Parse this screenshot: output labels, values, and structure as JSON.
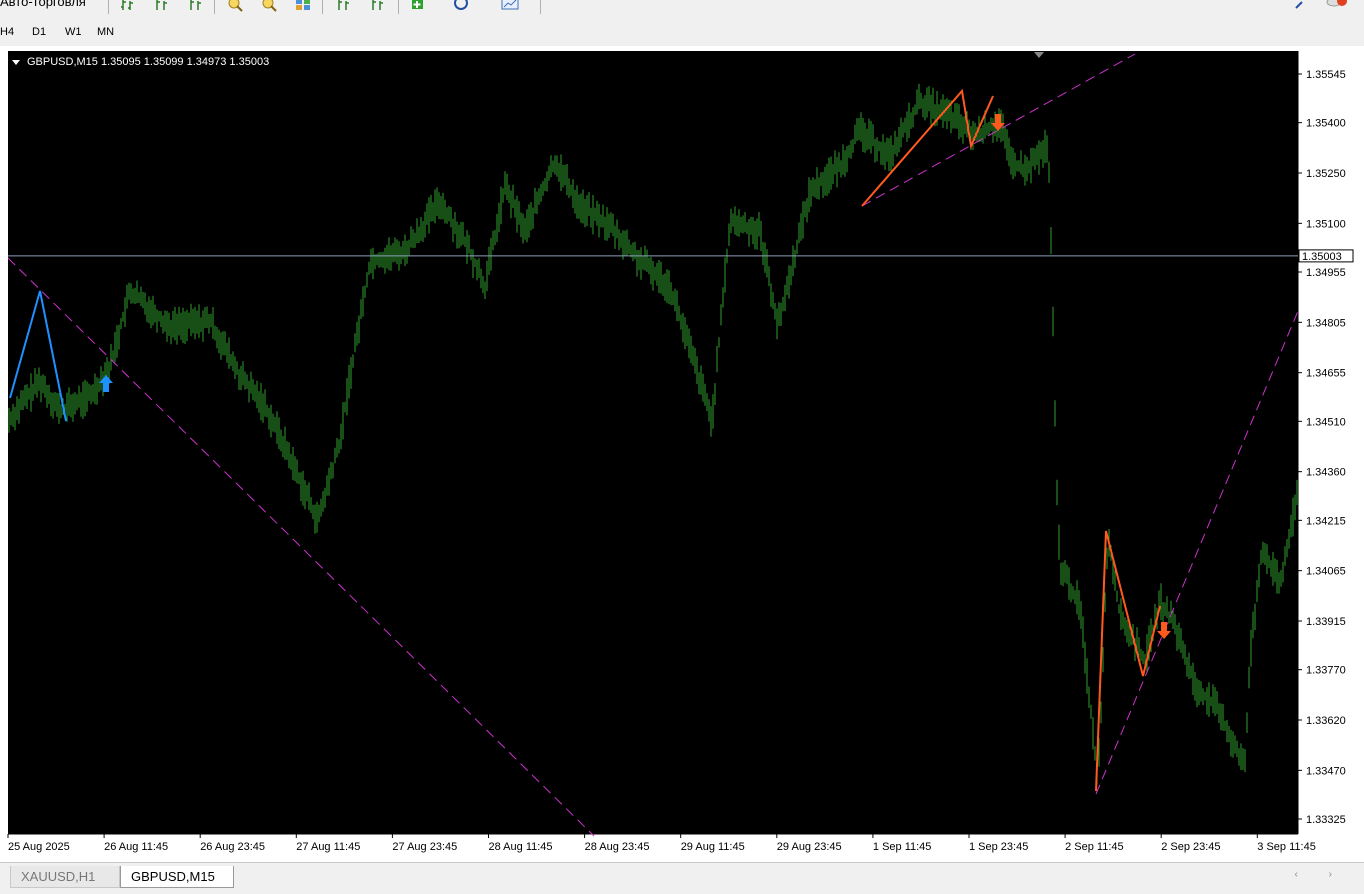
{
  "toolbar": {
    "autotrading_label": "Авто-торговля",
    "icons": [
      "chart-bars-icon",
      "chart-candles-icon",
      "chart-line-icon",
      "zoom-in-icon",
      "zoom-out-icon",
      "tile-windows-icon",
      "period-separators-icon",
      "grid-icon",
      "indicators-icon",
      "navigator-icon",
      "templates-icon"
    ]
  },
  "timeframes": [
    "H4",
    "D1",
    "W1",
    "MN"
  ],
  "chart": {
    "symbol_info": "GBPUSD,M15  1.35095 1.35099 1.34973 1.35003",
    "current_price": "1.35003",
    "price_scale": [
      "1.35545",
      "1.35400",
      "1.35250",
      "1.35100",
      "1.34955",
      "1.34805",
      "1.34655",
      "1.34510",
      "1.34360",
      "1.34215",
      "1.34065",
      "1.33915",
      "1.33770",
      "1.33620",
      "1.33470",
      "1.33325"
    ],
    "time_scale": [
      "25 Aug 2025",
      "26 Aug 11:45",
      "26 Aug 23:45",
      "27 Aug 11:45",
      "27 Aug 23:45",
      "28 Aug 11:45",
      "28 Aug 23:45",
      "29 Aug 11:45",
      "29 Aug 23:45",
      "1 Sep 11:45",
      "1 Sep 23:45",
      "2 Sep 11:45",
      "2 Sep 23:45",
      "3 Sep 11:45"
    ],
    "colors": {
      "background": "#000000",
      "bars": "#2e9e2e",
      "bid_line": "#8aa0b8",
      "trendline": "#cc33cc",
      "pattern_blue": "#1e90ff",
      "pattern_orange": "#ff5a1e"
    }
  },
  "tabs": [
    {
      "label": "XAUUSD,H1",
      "active": false
    },
    {
      "label": "GBPUSD,M15",
      "active": true
    }
  ]
}
